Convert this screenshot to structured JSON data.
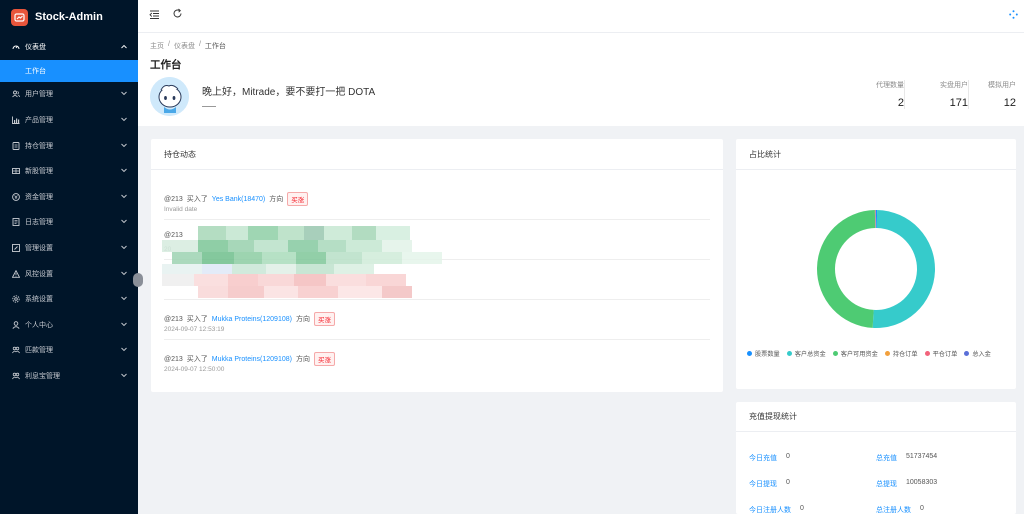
{
  "app": {
    "title": "Stock-Admin"
  },
  "sidebar": {
    "items": [
      {
        "label": "仪表盘",
        "icon": "dashboard-icon",
        "open": true,
        "children": [
          {
            "label": "工作台",
            "active": true
          }
        ]
      },
      {
        "label": "用户管理",
        "icon": "users-icon"
      },
      {
        "label": "产品管理",
        "icon": "bar-chart-icon"
      },
      {
        "label": "持仓管理",
        "icon": "file-icon"
      },
      {
        "label": "新股管理",
        "icon": "grid-icon"
      },
      {
        "label": "资金管理",
        "icon": "money-icon"
      },
      {
        "label": "日志管理",
        "icon": "document-icon"
      },
      {
        "label": "管理设置",
        "icon": "edit-icon"
      },
      {
        "label": "风控设置",
        "icon": "warning-icon"
      },
      {
        "label": "系统设置",
        "icon": "gear-icon"
      },
      {
        "label": "个人中心",
        "icon": "user-icon"
      },
      {
        "label": "匹款管理",
        "icon": "people-icon"
      },
      {
        "label": "利息宝管理",
        "icon": "people-icon"
      }
    ]
  },
  "breadcrumb": [
    "主页",
    "仪表盘",
    "工作台"
  ],
  "page": {
    "title": "工作台",
    "greeting": "晚上好，Mitrade，要不要打一把 DOTA"
  },
  "stats": [
    {
      "label": "代理数量",
      "value": "2"
    },
    {
      "label": "实盘用户",
      "value": "171"
    },
    {
      "label": "模拟用户",
      "value": "12"
    }
  ],
  "positions": {
    "title": "持仓动态",
    "items": [
      {
        "user": "@213",
        "action": "买入了",
        "stock": "Yes Bank(18470)",
        "dir_label": "方向",
        "tag": "买涨",
        "time": "Invalid date"
      },
      {
        "user": "@213",
        "action": "",
        "stock": "",
        "dir_label": "",
        "tag": "",
        "time": "20"
      },
      {
        "user": "",
        "action": "",
        "stock": "",
        "dir_label": "",
        "tag": "",
        "time": ""
      },
      {
        "user": "@213",
        "action": "买入了",
        "stock": "Mukka Proteins(1209108)",
        "dir_label": "方向",
        "tag": "买涨",
        "time": "2024-09-07 12:53:19"
      },
      {
        "user": "@213",
        "action": "买入了",
        "stock": "Mukka Proteins(1209108)",
        "dir_label": "方向",
        "tag": "买涨",
        "time": "2024-09-07 12:50:00"
      }
    ]
  },
  "ratio": {
    "title": "占比统计",
    "legend": [
      {
        "label": "股票数量",
        "color": "#1890ff"
      },
      {
        "label": "客户总资金",
        "color": "#36cbcb"
      },
      {
        "label": "客户可用资金",
        "color": "#4ecb73"
      },
      {
        "label": "持仓订单",
        "color": "#f2a03d"
      },
      {
        "label": "平仓订单",
        "color": "#f2637b"
      },
      {
        "label": "总入金",
        "color": "#5a6fd8"
      }
    ]
  },
  "chart_data": {
    "type": "pie",
    "title": "占比统计",
    "categories": [
      "股票数量",
      "客户总资金",
      "客户可用资金",
      "持仓订单",
      "平仓订单",
      "总入金"
    ],
    "values": [
      0.3,
      50.6,
      48.8,
      0.1,
      0.1,
      0.1
    ],
    "colors": [
      "#1890ff",
      "#36cbcb",
      "#4ecb73",
      "#f2a03d",
      "#f2637b",
      "#5a6fd8"
    ],
    "donut": true,
    "legend": "bottom"
  },
  "recharge": {
    "title": "充值提现统计",
    "rows": [
      {
        "label": "今日充值",
        "value": "0"
      },
      {
        "label": "总充值",
        "value": "51737454"
      },
      {
        "label": "今日提现",
        "value": "0"
      },
      {
        "label": "总提现",
        "value": "10058303"
      },
      {
        "label": "今日注册人数",
        "value": "0"
      },
      {
        "label": "总注册人数",
        "value": "0"
      }
    ]
  },
  "colors": {
    "sidebar_bg": "#001529",
    "accent": "#1890ff",
    "tag_red": "#f5222d"
  }
}
